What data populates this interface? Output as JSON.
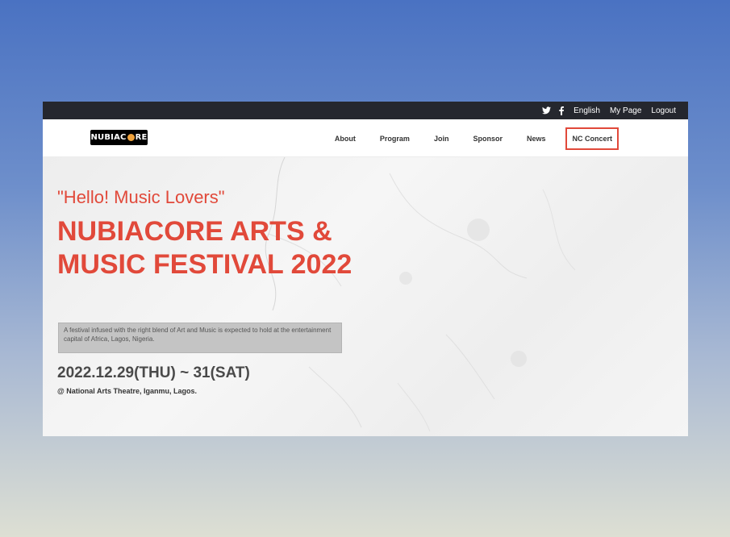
{
  "topbar": {
    "icons": [
      "twitter-icon",
      "facebook-icon"
    ],
    "links": {
      "language": "English",
      "my_page": "My Page",
      "logout": "Logout"
    }
  },
  "header": {
    "logo": {
      "part1": "NUBIAC",
      "part2": "RE"
    },
    "nav": {
      "about": "About",
      "program": "Program",
      "join": "Join",
      "sponsor": "Sponsor",
      "news": "News",
      "nc_concert": "NC Concert"
    }
  },
  "hero": {
    "greeting": "\"Hello! Music Lovers\"",
    "title": "NUBIACORE ARTS & MUSIC FESTIVAL 2022",
    "description": "A festival infused with the right blend of Art and Music is expected to hold at the entertainment capital of Africa, Lagos, Nigeria.",
    "date": "2022.12.29(THU) ~ 31(SAT)",
    "venue": "@ National Arts Theatre, Iganmu, Lagos."
  },
  "colors": {
    "accent": "#e1493a",
    "topbar": "#25272e",
    "highlight_border": "#e1493a"
  }
}
